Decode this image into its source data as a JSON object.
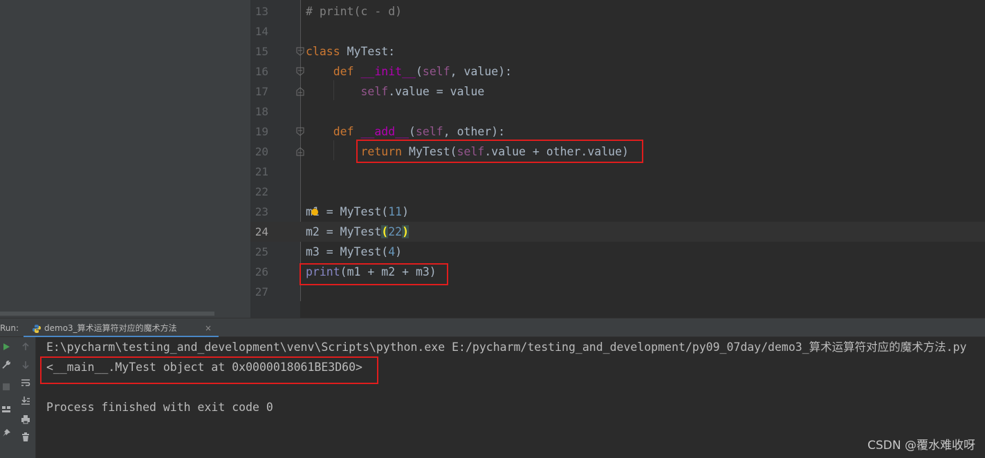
{
  "editor": {
    "lines": [
      {
        "n": "13",
        "tokens": [
          {
            "t": "# print(c - d)",
            "c": "cmt"
          }
        ]
      },
      {
        "n": "14",
        "tokens": []
      },
      {
        "n": "15",
        "tokens": [
          {
            "t": "class ",
            "c": "kw"
          },
          {
            "t": "MyTest:",
            "c": ""
          }
        ]
      },
      {
        "n": "16",
        "tokens": [
          {
            "t": "    ",
            "c": ""
          },
          {
            "t": "def ",
            "c": "kw"
          },
          {
            "t": "__init__",
            "c": "magic"
          },
          {
            "t": "(",
            "c": ""
          },
          {
            "t": "self",
            "c": "self"
          },
          {
            "t": ", value):",
            "c": ""
          }
        ]
      },
      {
        "n": "17",
        "tokens": [
          {
            "t": "        ",
            "c": ""
          },
          {
            "t": "self",
            "c": "self"
          },
          {
            "t": ".value = value",
            "c": ""
          }
        ]
      },
      {
        "n": "18",
        "tokens": []
      },
      {
        "n": "19",
        "tokens": [
          {
            "t": "    ",
            "c": ""
          },
          {
            "t": "def ",
            "c": "kw"
          },
          {
            "t": "__add__",
            "c": "magic"
          },
          {
            "t": "(",
            "c": ""
          },
          {
            "t": "self",
            "c": "self"
          },
          {
            "t": ", other):",
            "c": ""
          }
        ]
      },
      {
        "n": "20",
        "tokens": [
          {
            "t": "        ",
            "c": ""
          },
          {
            "t": "return ",
            "c": "kw"
          },
          {
            "t": "MyTest(",
            "c": ""
          },
          {
            "t": "self",
            "c": "self"
          },
          {
            "t": ".value + other.value)",
            "c": ""
          }
        ]
      },
      {
        "n": "21",
        "tokens": []
      },
      {
        "n": "22",
        "tokens": []
      },
      {
        "n": "23",
        "tokens": [
          {
            "t": "m1 = MyTest(",
            "c": ""
          },
          {
            "t": "11",
            "c": "num"
          },
          {
            "t": ")",
            "c": ""
          }
        ]
      },
      {
        "n": "24",
        "tokens": [
          {
            "t": "m2 = MyTest",
            "c": ""
          },
          {
            "t": "(",
            "c": "brace-match"
          },
          {
            "t": "22",
            "c": "num"
          },
          {
            "t": ")",
            "c": "brace-match"
          }
        ]
      },
      {
        "n": "25",
        "tokens": [
          {
            "t": "m3 = MyTest(",
            "c": ""
          },
          {
            "t": "4",
            "c": "num"
          },
          {
            "t": ")",
            "c": ""
          }
        ]
      },
      {
        "n": "26",
        "tokens": [
          {
            "t": "print",
            "c": "builtin"
          },
          {
            "t": "(m1 + m2 + m3)",
            "c": ""
          }
        ]
      },
      {
        "n": "27",
        "tokens": []
      }
    ],
    "colors": {
      "keyword": "#cc7832",
      "self": "#94558d",
      "number": "#6897bb",
      "magic": "#b200b2",
      "comment": "#808080",
      "builtin": "#8888c6",
      "highlight_box": "#e01d1d"
    }
  },
  "run": {
    "label": "Run:",
    "tab_label": "demo3_算术运算符对应的魔术方法",
    "tab_close": "×",
    "tab_icon": "python-file-icon",
    "toolbar_icons": [
      "rerun-icon",
      "scroll-up-icon",
      "settings-wrench-icon",
      "scroll-down-icon",
      "stop-icon",
      "soft-wrap-icon",
      "scroll-to-end-icon",
      "layout-icon",
      "print-icon",
      "pin-icon",
      "trash-icon"
    ]
  },
  "console": {
    "cmd": "E:\\pycharm\\testing_and_development\\venv\\Scripts\\python.exe E:/pycharm/testing_and_development/py09_07day/demo3_算术运算符对应的魔术方法.py",
    "output": "<__main__.MyTest object at 0x0000018061BE3D60>",
    "blank": "",
    "exit": "Process finished with exit code 0"
  },
  "watermark": "CSDN @覆水难收呀"
}
